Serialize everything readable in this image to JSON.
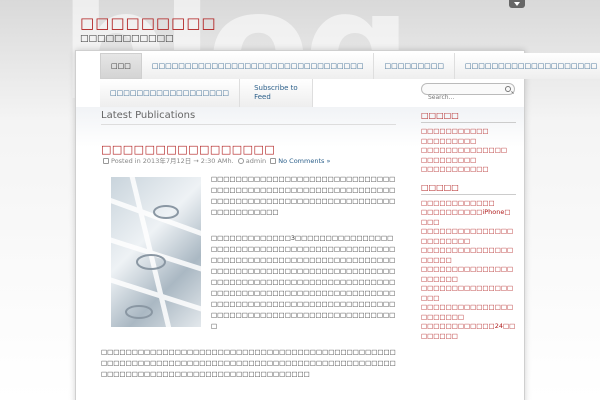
{
  "site": {
    "title": "□□□□□□□□□",
    "description": "□□□□□□□□□□□"
  },
  "nav": {
    "row1": [
      {
        "label": "□□□",
        "active": true
      },
      {
        "label": "□□□□□□□□□□□□□□□□□□□□□□□□□□□□□□□□"
      },
      {
        "label": "□□□□□□□□□"
      },
      {
        "label": "□□□□□□□□□□□□□□□□□□□□"
      }
    ],
    "row2": [
      {
        "label": "□□□□□□□□□□□□□□□□□□"
      }
    ],
    "subscribe": {
      "line1": "Subscribe to",
      "line2": "Feed"
    }
  },
  "search": {
    "placeholder": "Search..."
  },
  "main": {
    "section_title": "Latest Publications",
    "post": {
      "title": "□□□□□□□□□□□□□□□□",
      "meta_posted": "Posted in 2013年7月12日 → 2:30 AM",
      "meta_hour": "h.",
      "meta_author": "admin",
      "meta_comments": "No Comments »",
      "para1": "□□□□□□□□□□□□□□□□□□□□□□□□□□□□□□□□□□□□□□□□□□□□□□□□□□□□□□□□□□□□□□□□□□□□□□□□□□□□□□□□□□□□□□□□□□□□□□□□□□□□□",
      "para2": "□□□□□□□□□□□□□3□□□□□□□□□□□□□□□□□□□□□□□□□□□□□□□□□□□□□□□□□□□□□□□□□□□□□□□□□□□□□□□□□□□□□□□□□□□□□□□□□□□□□□□□□□□□□□□□□□□□□□□□□□□□□□□□□□□□□□□□□□□□□□□□□□□□□□□□□□□□□□□□□□□□□□□□□□□□□□□□□□□□□□□□□□□□□□□□□□□□□□□□□□□□□□□□□□□□□□□□□□□□□□□□□□□□□□□□□□□□□□□□□□□",
      "para3": "□□□□□□□□□□□□□□□□□□□□□□□□□□□□□□□□□□□□□□□□□□□□□□□□□□□□□□□□□□□□□□□□□□□□□□□□□□□□□□□□□□□□□□□□□□□□□□□□□□□□□□□□□□□□□□□□□□□□□□□□□□□□□□□□□□"
    }
  },
  "sidebar": {
    "widget1": {
      "title": "□□□□□",
      "links": [
        "□□□□□□□□□□□",
        "□□□□□□□□□",
        "□□□□□□□□□□□□□□",
        "□□□□□□□□□",
        "□□□□□□□□□□□"
      ]
    },
    "widget2": {
      "title": "□□□□□",
      "links": [
        "□□□□□□□□□□□□",
        "□□□□□□□□□□iPhone□□□□",
        "□□□□□□□□□□□□□□□□□□□□□□□",
        "□□□□□□□□□□□□□□□□□□□□",
        "□□□□□□□□□□□□□□□□□□□□□",
        "□□□□□□□□□□□□□□□□□□",
        "□□□□□□□□□□□□□□□□□□□□□□",
        "□□□□□□□□□□□□24□□□□□□□□"
      ]
    }
  },
  "colors": {
    "accent": "#b01c1c",
    "nav_link": "#2b5f8a",
    "side_tab": "#3a6fa5"
  }
}
